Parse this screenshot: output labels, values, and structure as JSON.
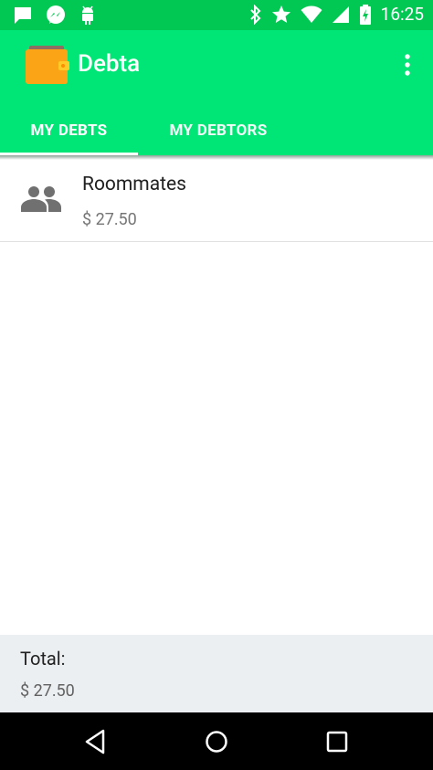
{
  "status_bar": {
    "time": "16:25",
    "left_icons": [
      "message-icon",
      "messenger-icon",
      "android-icon"
    ],
    "right_icons": [
      "bluetooth-icon",
      "star-icon",
      "wifi-icon",
      "signal-icon",
      "battery-charging-icon"
    ]
  },
  "app_bar": {
    "title": "Debta",
    "logo_icon": "wallet-icon",
    "menu_icon": "overflow-menu-icon",
    "colors": {
      "status_bar": "#00c853",
      "app_bar": "#00e676"
    }
  },
  "tabs": [
    {
      "label": "MY DEBTS",
      "selected": true
    },
    {
      "label": "MY DEBTORS",
      "selected": false
    }
  ],
  "debts": [
    {
      "name": "Roommates",
      "amount": "$ 27.50",
      "icon": "group-icon"
    }
  ],
  "total": {
    "label": "Total:",
    "amount": "$ 27.50"
  },
  "nav_bar": {
    "buttons": [
      "back-icon",
      "home-icon",
      "recents-icon"
    ]
  }
}
